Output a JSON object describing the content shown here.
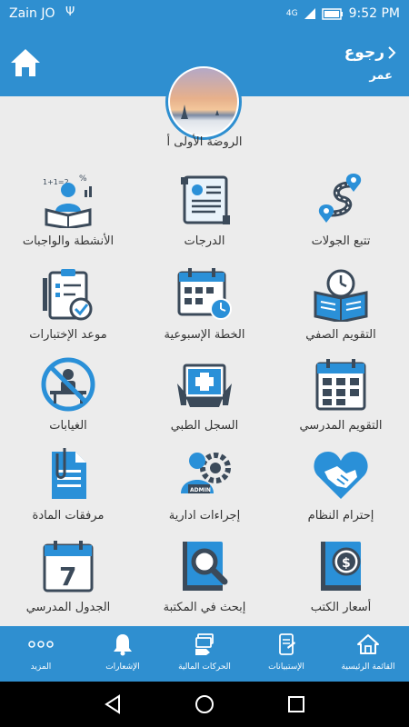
{
  "status_bar": {
    "carrier": "Zain JO",
    "usb_symbol": "Ψ",
    "network": "4G",
    "time": "9:52 PM"
  },
  "header": {
    "back_label": "رجوع",
    "user_name": "عمر"
  },
  "class_name": "الروضة الأولى أ",
  "grid": [
    {
      "label": "تتبع الجولات",
      "icon": "route-tracking-icon"
    },
    {
      "label": "الدرجات",
      "icon": "certificate-scroll-icon"
    },
    {
      "label": "الأنشطة والواجبات",
      "icon": "student-reading-icon"
    },
    {
      "label": "التقويم الصفي",
      "icon": "book-clock-icon"
    },
    {
      "label": "الخطة الإسبوعية",
      "icon": "calendar-clock-icon"
    },
    {
      "label": "موعد الإختبارات",
      "icon": "clipboard-check-icon"
    },
    {
      "label": "التقويم المدرسي",
      "icon": "calendar-grid-icon"
    },
    {
      "label": "السجل الطبي",
      "icon": "medical-folder-icon"
    },
    {
      "label": "الغيابات",
      "icon": "no-student-icon"
    },
    {
      "label": "إحترام النظام",
      "icon": "handshake-heart-icon"
    },
    {
      "label": "إجراءات ادارية",
      "icon": "admin-gear-icon"
    },
    {
      "label": "مرفقات المادة",
      "icon": "attachment-document-icon"
    },
    {
      "label": "أسعار الكتب",
      "icon": "book-price-icon"
    },
    {
      "label": "إبحث في المكتبة",
      "icon": "library-search-icon"
    },
    {
      "label": "الجدول المدرسي",
      "icon": "calendar-seven-icon"
    }
  ],
  "bottom_nav": [
    {
      "label": "القائمة الرئيسية",
      "icon": "home-outline-icon"
    },
    {
      "label": "الإستبيانات",
      "icon": "survey-phone-icon"
    },
    {
      "label": "الحركات المالية",
      "icon": "money-hand-icon"
    },
    {
      "label": "الإشعارات",
      "icon": "bell-icon"
    },
    {
      "label": "المزيد",
      "icon": "more-dots-icon"
    }
  ],
  "colors": {
    "brand_blue": "#2f8fd0",
    "icon_blue": "#2a90d8",
    "icon_dark": "#3b4a5a",
    "background": "#ececec"
  }
}
